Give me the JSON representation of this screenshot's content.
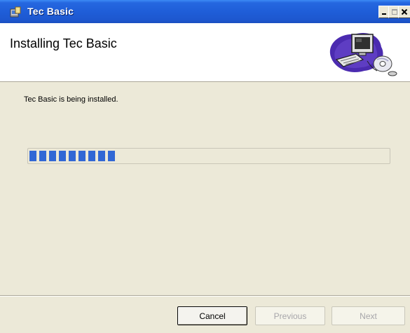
{
  "window": {
    "title": "Tec Basic",
    "icon": "installer-icon",
    "controls": {
      "minimize": "minimize-icon",
      "maximize": "maximize-icon",
      "close": "close-icon"
    }
  },
  "banner": {
    "title": "Installing Tec Basic",
    "art": "computer-cd-illustration"
  },
  "main": {
    "status_text": "Tec Basic is being installed.",
    "progress_fraction": 0.24,
    "progress_color": "#3168d5"
  },
  "footer": {
    "cancel_label": "Cancel",
    "previous_label": "Previous",
    "next_label": "Next",
    "previous_enabled": false,
    "next_enabled": false
  }
}
